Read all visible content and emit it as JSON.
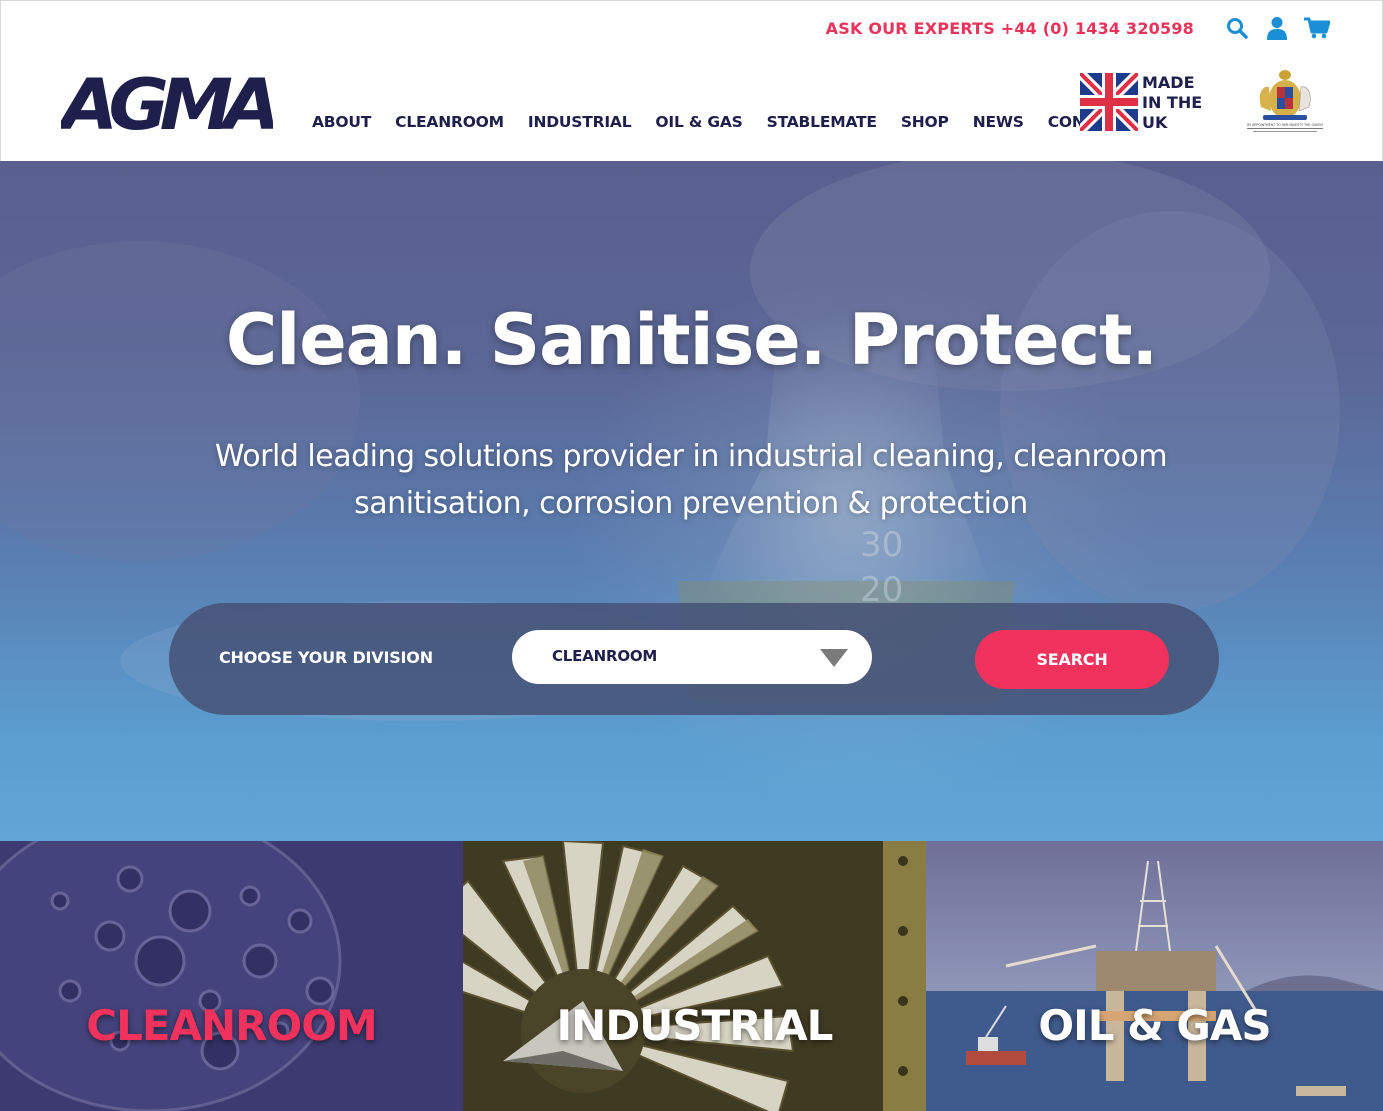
{
  "header": {
    "phone_text": "ASK OUR EXPERTS +44 (0) 1434 320598",
    "icons": [
      "search-icon",
      "account-icon",
      "cart-icon"
    ],
    "logo_text": "AGMA",
    "nav": [
      {
        "label": "ABOUT"
      },
      {
        "label": "CLEANROOM"
      },
      {
        "label": "INDUSTRIAL"
      },
      {
        "label": "OIL & GAS"
      },
      {
        "label": "STABLEMATE"
      },
      {
        "label": "SHOP"
      },
      {
        "label": "NEWS"
      },
      {
        "label": "CONTACT"
      }
    ],
    "made_in_uk": {
      "line1": "MADE",
      "line2": "IN THE",
      "line3": "UK"
    },
    "royal_warrant_text": "BY APPOINTMENT TO HER MAJESTY THE QUEEN"
  },
  "hero": {
    "title": "Clean. Sanitise. Protect.",
    "subtitle_line1": "World leading solutions provider in industrial cleaning, cleanroom",
    "subtitle_line2": "sanitisation, corrosion prevention & protection",
    "division_label": "CHOOSE YOUR DIVISION",
    "division_selected": "CLEANROOM",
    "search_label": "SEARCH"
  },
  "tiles": [
    {
      "label": "CLEANROOM",
      "color": "#f0325c"
    },
    {
      "label": "INDUSTRIAL",
      "color": "#ffffff"
    },
    {
      "label": "OIL & GAS",
      "color": "#ffffff"
    }
  ],
  "colors": {
    "accent": "#f0325c",
    "navy": "#1e1f4b",
    "icon_blue": "#1a8fd6"
  }
}
